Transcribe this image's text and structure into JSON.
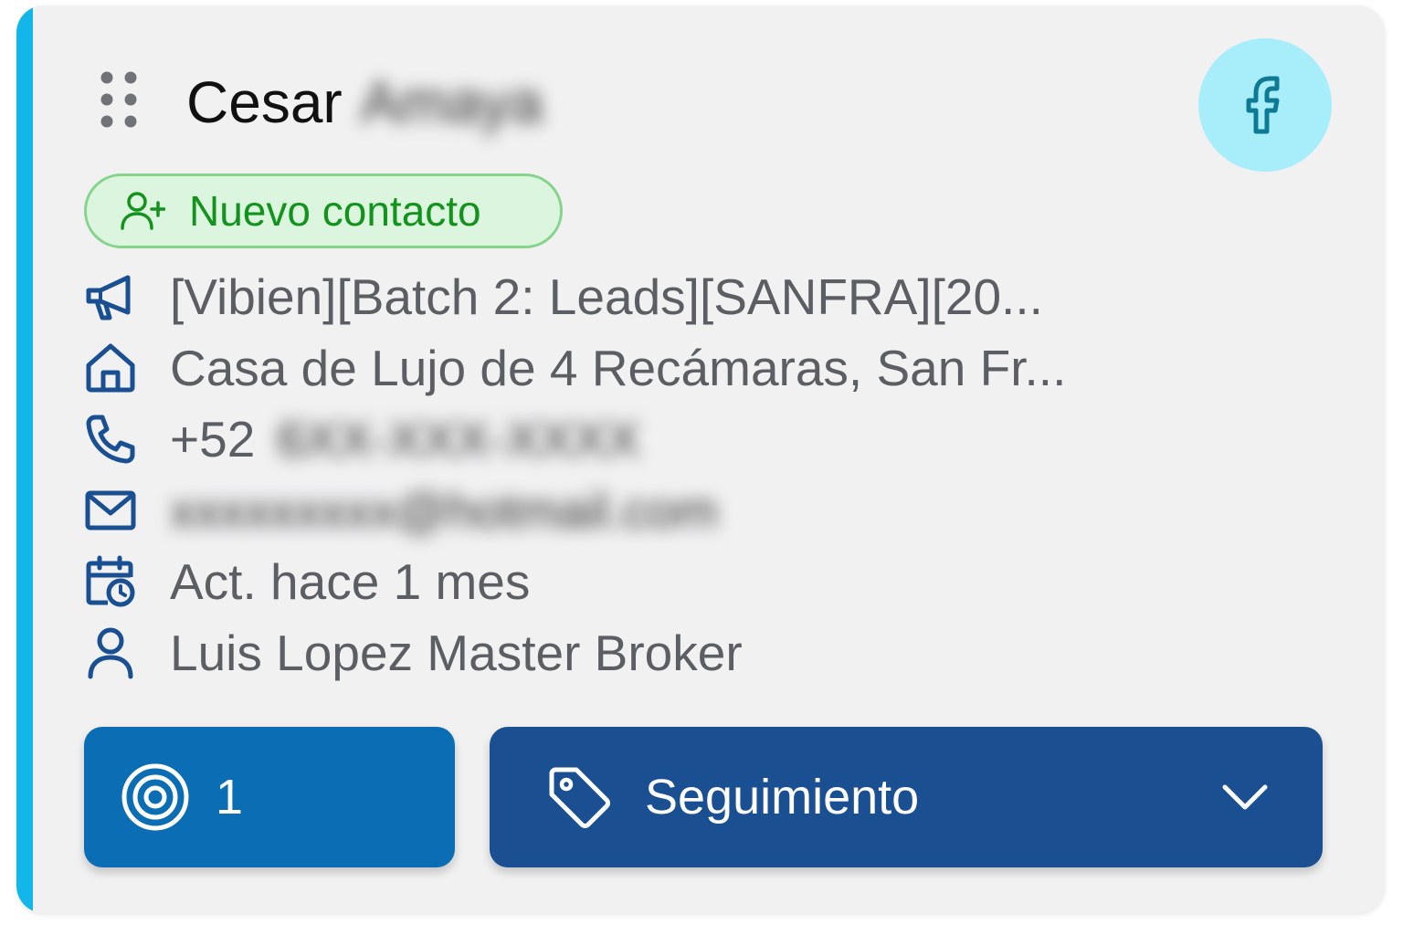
{
  "card": {
    "contact_first_name": "Cesar",
    "contact_last_name_blurred": "Amaya",
    "source_icon": "facebook-icon",
    "accent_color": "#13b6e8",
    "status": {
      "label": "Nuevo contacto",
      "icon": "user-plus-icon",
      "color": "#13921e"
    },
    "campaign": "[Vibien][Batch 2: Leads][SANFRA][20...",
    "property": "Casa de Lujo de 4 Recámaras, San Fr...",
    "phone_prefix": "+52",
    "phone_blurred": "6XX-XXX-XXXX",
    "email_blurred": "xxxxxxxxx@hotmail.com",
    "last_activity": "Act. hace 1 mes",
    "agent": "Luis Lopez Master Broker",
    "opportunities_count": "1",
    "stage_label": "Seguimiento",
    "colors": {
      "count_button": "#0b6db4",
      "stage_button": "#1a4f91",
      "icon_blue": "#1a4f91"
    }
  }
}
